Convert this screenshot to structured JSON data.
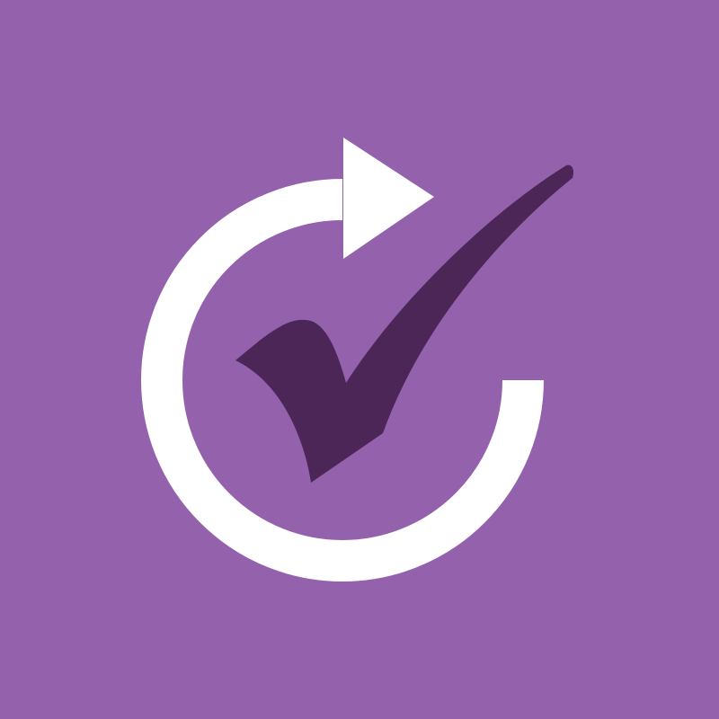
{
  "app_icon": {
    "icons": [
      "refresh-arrow-icon",
      "checkmark-icon"
    ],
    "colors": {
      "background": "#9461AD",
      "arrow": "#FFFFFF",
      "checkmark": "#4D2658"
    }
  }
}
